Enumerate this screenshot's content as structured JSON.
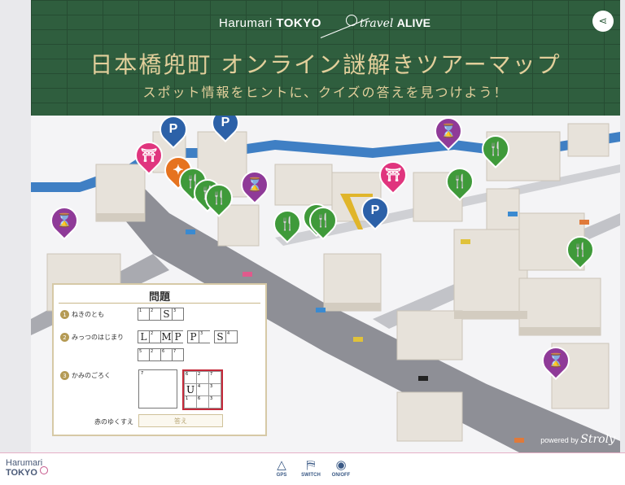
{
  "header": {
    "brand_harumari": "Harumari",
    "brand_tokyo": "TOKYO",
    "brand_travel": "travel",
    "brand_alive": "ALIVE",
    "title": "日本橋兜町 オンライン謎解きツアーマップ",
    "subtitle": "スポット情報をヒントに、クイズの答えを見つけよう！",
    "share_icon": "share-icon"
  },
  "colors": {
    "header_bg": "#2f5e3e",
    "title_gold": "#e2cf9b",
    "pin_hourglass": "#8f3a98",
    "pin_parking": "#2c61a8",
    "pin_food": "#3f9a3a",
    "pin_shrine": "#e0357e",
    "accent_red": "#c4293a"
  },
  "map": {
    "pins": [
      {
        "type": "hourglass",
        "glyph": "⌛"
      },
      {
        "type": "hourglass",
        "glyph": "⌛"
      },
      {
        "type": "shrine",
        "glyph": "⛩"
      },
      {
        "type": "parking",
        "glyph": "P"
      },
      {
        "type": "parking",
        "glyph": "P"
      },
      {
        "type": "orange",
        "glyph": "✦"
      },
      {
        "type": "food",
        "glyph": "🍴"
      },
      {
        "type": "food",
        "glyph": "🍴"
      },
      {
        "type": "food",
        "glyph": "🍴"
      },
      {
        "type": "hourglass",
        "glyph": "⌛"
      },
      {
        "type": "food",
        "glyph": "🍴"
      },
      {
        "type": "food",
        "glyph": "🍴"
      },
      {
        "type": "food",
        "glyph": "🍴"
      },
      {
        "type": "parking",
        "glyph": "P"
      },
      {
        "type": "shrine",
        "glyph": "⛩"
      },
      {
        "type": "hourglass",
        "glyph": "⌛"
      },
      {
        "type": "food",
        "glyph": "🍴"
      },
      {
        "type": "food",
        "glyph": "🍴"
      },
      {
        "type": "food",
        "glyph": "🍴"
      },
      {
        "type": "hourglass",
        "glyph": "⌛"
      }
    ],
    "powered_by": "powered by",
    "powered_brand": "Stroly"
  },
  "quiz": {
    "title": "問題",
    "q1": {
      "num": "1",
      "label": "ねきのとも",
      "cells": [
        {
          "n": "1",
          "v": ""
        },
        {
          "n": "2",
          "v": ""
        },
        {
          "n": "",
          "v": "S"
        },
        {
          "n": "3",
          "v": ""
        }
      ]
    },
    "q2": {
      "num": "2",
      "label": "みっつのはじまり",
      "cells": [
        {
          "n": "",
          "v": "L"
        },
        {
          "n": "2",
          "v": ""
        },
        {
          "n": "",
          "v": "M"
        },
        {
          "n": "",
          "v": "P"
        },
        {
          "n": "",
          "v": "gap"
        },
        {
          "n": "",
          "v": "P"
        },
        {
          "n": "3",
          "v": ""
        },
        {
          "n": "",
          "v": "gap"
        },
        {
          "n": "",
          "v": "S"
        },
        {
          "n": "4",
          "v": ""
        }
      ],
      "cells2": [
        {
          "n": "5",
          "v": ""
        },
        {
          "n": "2",
          "v": ""
        },
        {
          "n": "6",
          "v": ""
        },
        {
          "n": "7",
          "v": ""
        }
      ]
    },
    "q3": {
      "num": "3",
      "label": "かみのごろく",
      "box1_num": "7",
      "box2": [
        {
          "n": "6",
          "v": ""
        },
        {
          "n": "2",
          "v": ""
        },
        {
          "n": "7",
          "v": ""
        },
        {
          "n": "",
          "v": "U"
        },
        {
          "n": "4",
          "v": ""
        },
        {
          "n": "3",
          "v": ""
        },
        {
          "n": "1",
          "v": ""
        },
        {
          "n": "6",
          "v": ""
        },
        {
          "n": "3",
          "v": ""
        }
      ]
    },
    "answer_label": "赤のゆくすえ",
    "answer_button": "答え"
  },
  "bottom_bar": {
    "logo_line1": "Harumari",
    "logo_line2": "TOKYO",
    "buttons": [
      {
        "label": "GPS",
        "icon": "navigate-arrow-icon",
        "glyph": "△"
      },
      {
        "label": "SWITCH",
        "icon": "map-switch-icon",
        "glyph": "⛿"
      },
      {
        "label": "ON/OFF",
        "icon": "location-pin-icon",
        "glyph": "◉"
      }
    ]
  }
}
